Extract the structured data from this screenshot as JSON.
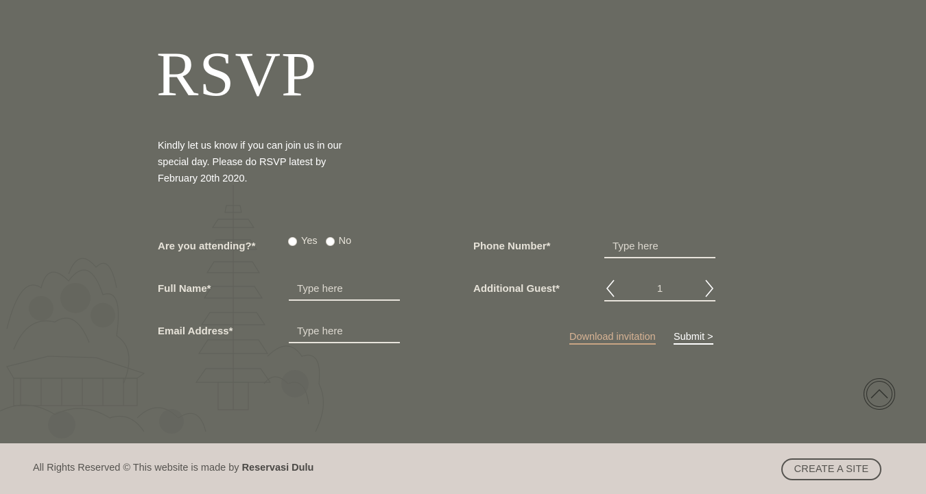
{
  "page": {
    "title": "RSVP"
  },
  "intro": "Kindly let us know if you can join us in our special day. Please do RSVP latest by February 20th 2020.",
  "form": {
    "attending": {
      "label": "Are you attending?*",
      "options": [
        "Yes",
        "No"
      ]
    },
    "full_name": {
      "label": "Full Name*",
      "placeholder": "Type here"
    },
    "email": {
      "label": "Email Address*",
      "placeholder": "Type here"
    },
    "phone": {
      "label": "Phone Number*",
      "placeholder": "Type here"
    },
    "guests": {
      "label": "Additional Guest*",
      "value": "1"
    },
    "download_label": "Download invitation",
    "submit_label": "Submit >"
  },
  "footer": {
    "copyright_prefix": "All Rights Reserved © This website is made by ",
    "brand": "Reservasi Dulu",
    "create_label": "CREATE A SITE"
  },
  "colors": {
    "background": "#696a62",
    "footer_bg": "#d8d0cb",
    "accent": "#d7b394",
    "text": "#ffffff"
  },
  "icons": {
    "scroll_top": "chevron-up-icon",
    "stepper_prev": "chevron-left-icon",
    "stepper_next": "chevron-right-icon"
  }
}
